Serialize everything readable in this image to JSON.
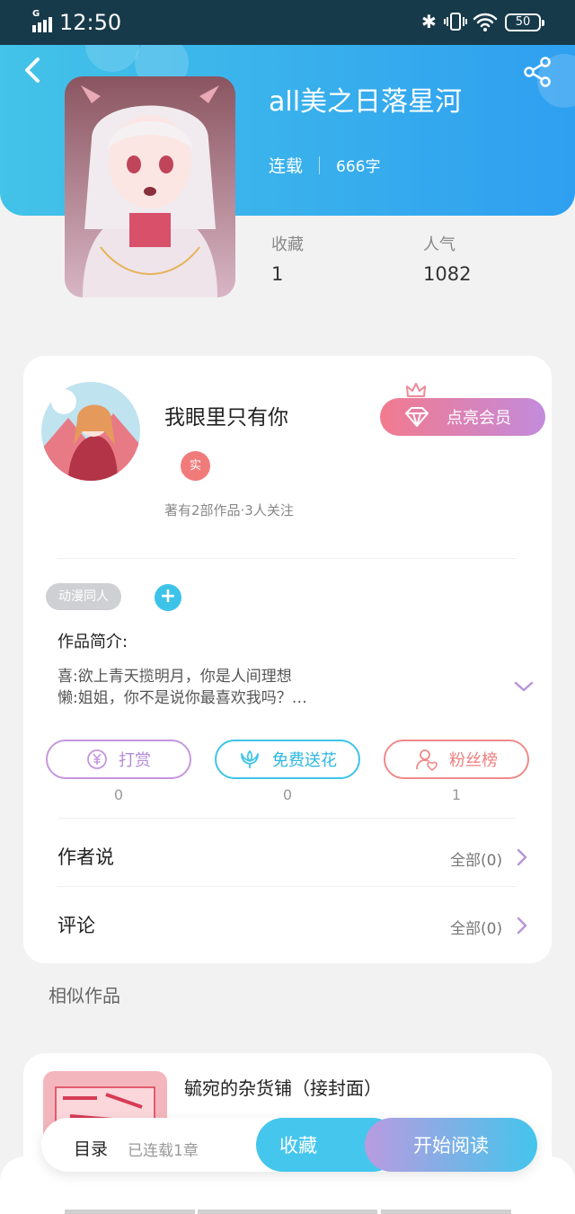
{
  "status_bar": {
    "time": "12:50",
    "network": "G",
    "battery": "50"
  },
  "book": {
    "title": "all美之日落星河",
    "status": "连载",
    "word_count": "666字"
  },
  "stats": {
    "favorites_label": "收藏",
    "favorites_value": "1",
    "popularity_label": "人气",
    "popularity_value": "1082"
  },
  "author": {
    "name": "我眼里只有你",
    "badge": "实",
    "stats_text": "著有2部作品·3人关注",
    "vip_button": "点亮会员"
  },
  "tags": [
    "动漫同人"
  ],
  "intro": {
    "title": "作品简介:",
    "lines": [
      "喜:欲上青天揽明月，你是人间理想",
      "懒:姐姐，你不是说你最喜欢我吗？…"
    ]
  },
  "actions": [
    {
      "label": "打赏",
      "count": "0",
      "color": "#c497de"
    },
    {
      "label": "免费送花",
      "count": "0",
      "color": "#3fc4e8"
    },
    {
      "label": "粉丝榜",
      "count": "1",
      "color": "#ef8a8a"
    }
  ],
  "rows": [
    {
      "label": "作者说",
      "right": "全部(0)"
    },
    {
      "label": "评论",
      "right": "全部(0)"
    }
  ],
  "similar": {
    "section_title": "相似作品",
    "items": [
      {
        "title": "毓宛的杂货铺（接封面）"
      }
    ]
  },
  "bottom_bar": {
    "toc_label": "目录",
    "toc_status": "已连载1章",
    "favorite_button": "收藏",
    "read_button": "开始阅读"
  },
  "colors": {
    "hero_start": "#43c3e8",
    "hero_end": "#2f9ff0",
    "vip_start": "#f27a8e",
    "vip_end": "#c38bdc",
    "accent_cyan": "#3dc3e8"
  }
}
